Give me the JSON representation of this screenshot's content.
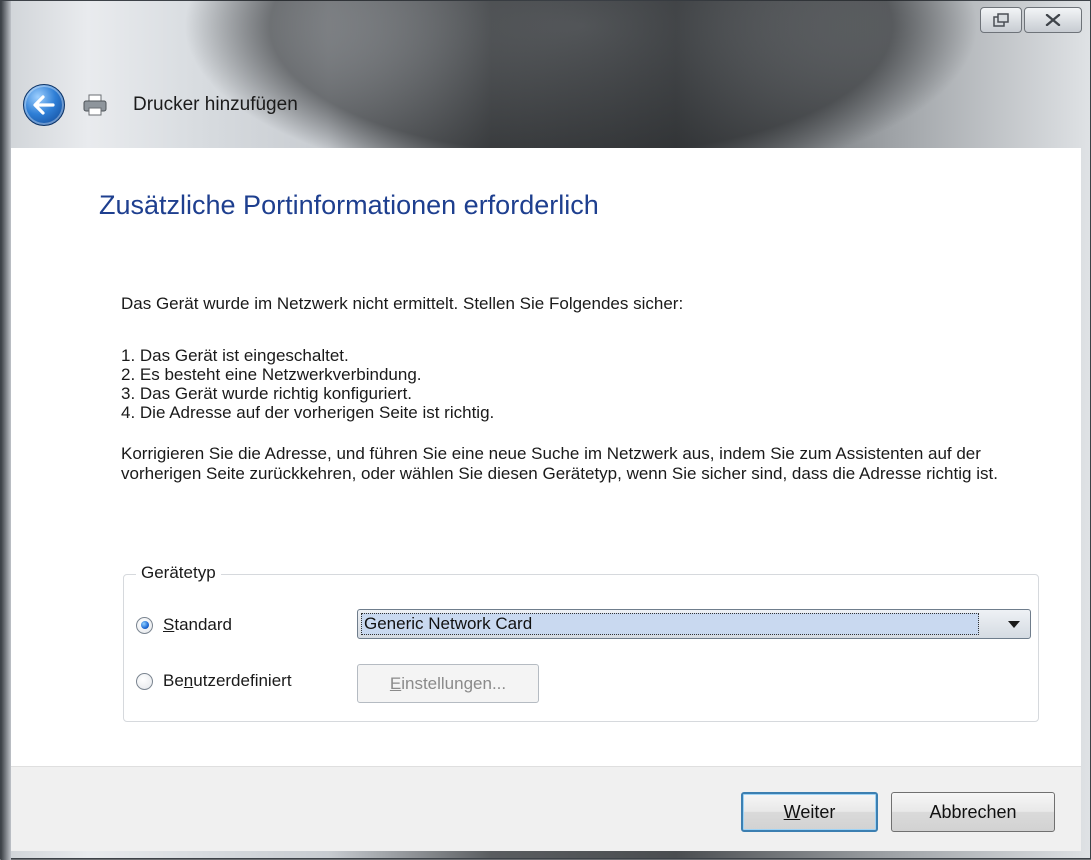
{
  "window": {
    "title": "Drucker hinzufügen",
    "icons": {
      "back": "back-arrow-icon",
      "app": "printer-icon",
      "restore": "restore-icon",
      "close": "close-icon"
    }
  },
  "content": {
    "heading": "Zusätzliche Portinformationen erforderlich",
    "intro": "Das Gerät wurde im Netzwerk nicht ermittelt. Stellen Sie Folgendes sicher:",
    "steps": [
      "1.  Das Gerät ist eingeschaltet.",
      "2.  Es besteht eine Netzwerkverbindung.",
      "3.  Das Gerät wurde richtig konfiguriert.",
      "4.  Die Adresse auf der vorherigen Seite ist richtig."
    ],
    "paragraph": "Korrigieren Sie die Adresse, und führen Sie eine neue Suche im Netzwerk aus, indem Sie zum Assistenten auf der vorherigen Seite zurückkehren, oder wählen Sie diesen Gerätetyp, wenn Sie sicher sind, dass die Adresse richtig ist."
  },
  "device_type": {
    "legend": "Gerätetyp",
    "standard": {
      "label_first": "S",
      "label_rest": "tandard",
      "selected": true
    },
    "custom": {
      "label_first": "Be",
      "label_ul": "n",
      "label_rest": "utzerdefiniert",
      "selected": false
    },
    "select_value": "Generic Network Card",
    "settings_ul": "E",
    "settings_rest": "instellungen..."
  },
  "buttons": {
    "next_ul": "W",
    "next_rest": "eiter",
    "cancel": "Abbrechen"
  },
  "colors": {
    "heading": "#1e3f8f",
    "default_button_border": "#3c7fb1"
  }
}
